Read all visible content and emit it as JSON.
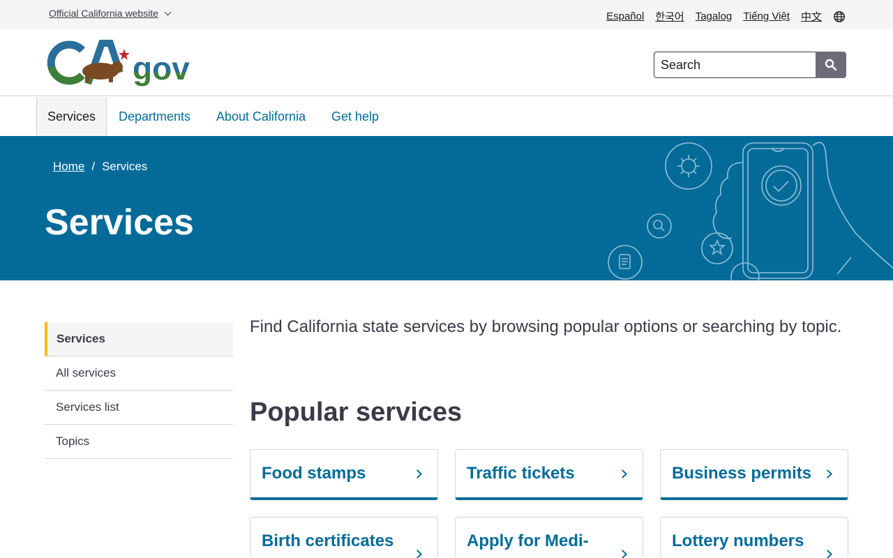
{
  "utility": {
    "official_label": "Official California website",
    "languages": [
      "Español",
      "한국어",
      "Tagalog",
      "Tiếng Việt",
      "中文"
    ]
  },
  "header": {
    "logo_text": "CA.gov",
    "search_placeholder": "Search"
  },
  "nav": {
    "items": [
      "Services",
      "Departments",
      "About California",
      "Get help"
    ],
    "active": "Services"
  },
  "hero": {
    "breadcrumb": [
      "Home",
      "Services"
    ],
    "title": "Services"
  },
  "sidebar": {
    "items": [
      "Services",
      "All services",
      "Services list",
      "Topics"
    ],
    "active": "Services"
  },
  "main": {
    "intro": "Find California state services by browsing popular options or searching by topic.",
    "popular_title": "Popular services",
    "cards": [
      "Food stamps",
      "Traffic tickets",
      "Business permits",
      "Birth certificates",
      "Apply for Medi-",
      "Lottery numbers"
    ]
  },
  "colors": {
    "primary": "#046b99",
    "accent": "#fdb81e",
    "text": "#3b3a48"
  }
}
